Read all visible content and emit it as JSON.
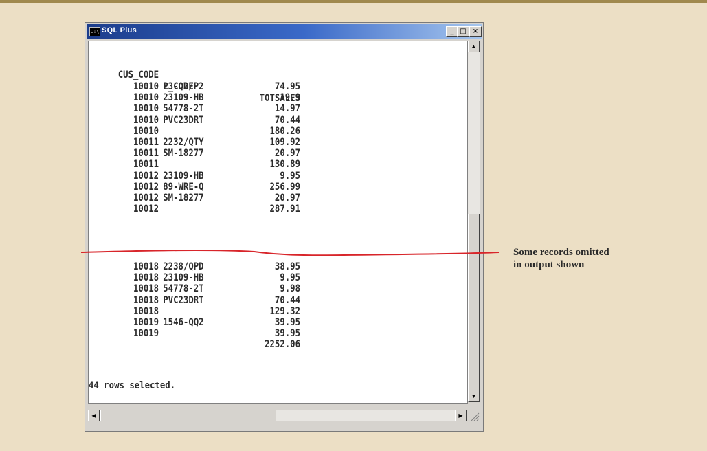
{
  "window": {
    "title": "SQL Plus",
    "icon": "console-icon"
  },
  "titlebar_buttons": {
    "minimize": "_",
    "maximize": "□",
    "close": "×"
  },
  "table": {
    "headers": {
      "cus_code": "CUS_CODE",
      "p_code": "P_CODE",
      "totsales": "TOTSALES"
    },
    "rows_top": [
      {
        "cus_code": "10010",
        "p_code": "13-Q2/P2",
        "totsales": "74.95"
      },
      {
        "cus_code": "10010",
        "p_code": "23109-HB",
        "totsales": "19.9"
      },
      {
        "cus_code": "10010",
        "p_code": "54778-2T",
        "totsales": "14.97"
      },
      {
        "cus_code": "10010",
        "p_code": "PVC23DRT",
        "totsales": "70.44"
      },
      {
        "cus_code": "10010",
        "p_code": "",
        "totsales": "180.26"
      },
      {
        "cus_code": "10011",
        "p_code": "2232/QTY",
        "totsales": "109.92"
      },
      {
        "cus_code": "10011",
        "p_code": "SM-18277",
        "totsales": "20.97"
      },
      {
        "cus_code": "10011",
        "p_code": "",
        "totsales": "130.89"
      },
      {
        "cus_code": "10012",
        "p_code": "23109-HB",
        "totsales": "9.95"
      },
      {
        "cus_code": "10012",
        "p_code": "89-WRE-Q",
        "totsales": "256.99"
      },
      {
        "cus_code": "10012",
        "p_code": "SM-18277",
        "totsales": "20.97"
      },
      {
        "cus_code": "10012",
        "p_code": "",
        "totsales": "287.91"
      }
    ],
    "rows_bottom": [
      {
        "cus_code": "10018",
        "p_code": "2238/QPD",
        "totsales": "38.95"
      },
      {
        "cus_code": "10018",
        "p_code": "23109-HB",
        "totsales": "9.95"
      },
      {
        "cus_code": "10018",
        "p_code": "54778-2T",
        "totsales": "9.98"
      },
      {
        "cus_code": "10018",
        "p_code": "PVC23DRT",
        "totsales": "70.44"
      },
      {
        "cus_code": "10018",
        "p_code": "",
        "totsales": "129.32"
      },
      {
        "cus_code": "10019",
        "p_code": "1546-QQ2",
        "totsales": "39.95"
      },
      {
        "cus_code": "10019",
        "p_code": "",
        "totsales": "39.95"
      },
      {
        "cus_code": "",
        "p_code": "",
        "totsales": "2252.06"
      }
    ],
    "rows_selected": "44 rows selected."
  },
  "annotation": {
    "line1": "Some records omitted",
    "line2": "in output shown"
  },
  "colors": {
    "annotation_line": "#d8252a",
    "background": "#ecdfc5",
    "titlebar": "#1c3d8c"
  }
}
